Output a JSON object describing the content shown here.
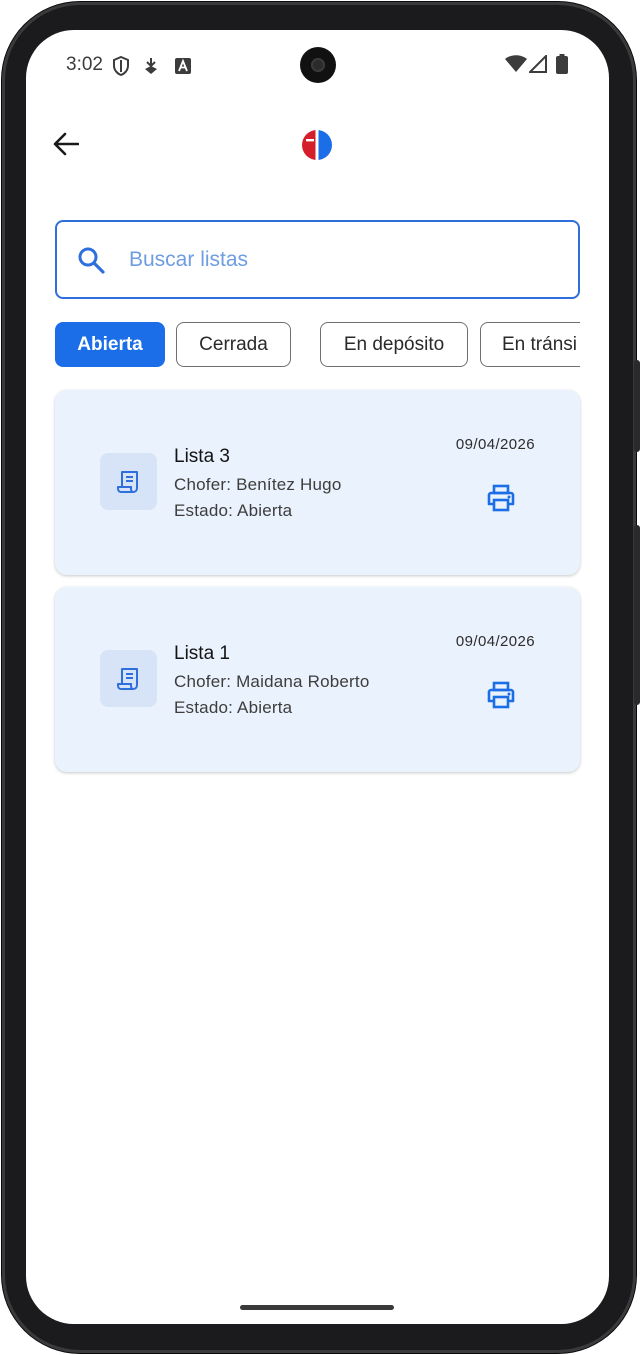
{
  "status_bar": {
    "time": "3:02",
    "left_icons": [
      "shield-icon",
      "download-app-icon",
      "text-a-icon"
    ],
    "right_icons": [
      "wifi-icon",
      "signal-icon",
      "battery-icon"
    ]
  },
  "app_bar": {
    "back_icon": "arrow-left-icon",
    "logo": "brand-logo"
  },
  "search": {
    "placeholder": "Buscar listas",
    "value": ""
  },
  "filters": [
    {
      "label": "Abierta",
      "selected": true
    },
    {
      "label": "Cerrada",
      "selected": false
    },
    {
      "label": "En depósito",
      "selected": false
    },
    {
      "label": "En tránsi",
      "selected": false
    }
  ],
  "lists": [
    {
      "title": "Lista 3",
      "driver": "Chofer: Benítez Hugo",
      "status": "Estado: Abierta",
      "date": "09/04/2026",
      "icon": "receipt-icon",
      "action_icon": "print-icon"
    },
    {
      "title": "Lista 1",
      "driver": "Chofer: Maidana Roberto",
      "status": "Estado: Abierta",
      "date": "09/04/2026",
      "icon": "receipt-icon",
      "action_icon": "print-icon"
    }
  ],
  "colors": {
    "accent": "#1c6ee8",
    "card_bg": "#eaf2fd",
    "icon_box_bg": "#d7e4f8",
    "logo_red": "#d41f2b",
    "logo_blue": "#1c6ee8"
  }
}
